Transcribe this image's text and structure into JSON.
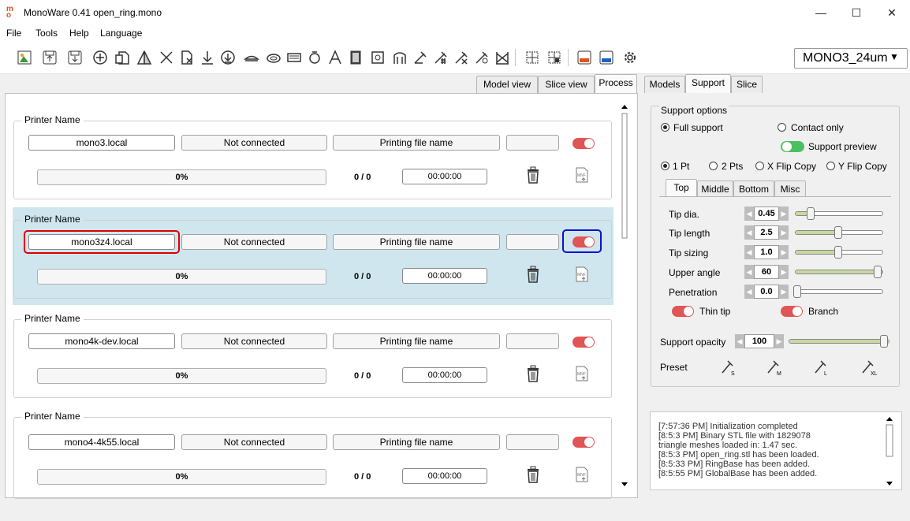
{
  "app": {
    "title": "MonoWare 0.41   open_ring.mono"
  },
  "window_controls": {
    "minimize": "—",
    "maximize": "☐",
    "close": "✕"
  },
  "menu": [
    "File",
    "Tools",
    "Help",
    "Language"
  ],
  "toolbar": {
    "material": "MONO3_24um"
  },
  "view_tabs": [
    "Model view",
    "Slice view",
    "Process"
  ],
  "right_tabs": [
    "Models",
    "Support",
    "Slice"
  ],
  "printers": [
    {
      "group_label": "Printer Name",
      "host": "mono3.local",
      "status": "Not connected",
      "file": "Printing file name",
      "progress": "0%",
      "layers": "0 / 0",
      "time": "00:00:00"
    },
    {
      "group_label": "Printer Name",
      "host": "mono3z4.local",
      "status": "Not connected",
      "file": "Printing file name",
      "progress": "0%",
      "layers": "0 / 0",
      "time": "00:00:00"
    },
    {
      "group_label": "Printer Name",
      "host": "mono4k-dev.local",
      "status": "Not connected",
      "file": "Printing file name",
      "progress": "0%",
      "layers": "0 / 0",
      "time": "00:00:00"
    },
    {
      "group_label": "Printer Name",
      "host": "mono4-4k55.local",
      "status": "Not connected",
      "file": "Printing file name",
      "progress": "0%",
      "layers": "0 / 0",
      "time": "00:00:00"
    }
  ],
  "support": {
    "group_label": "Support options",
    "full_support": "Full support",
    "contact_only": "Contact only",
    "support_preview": "Support preview",
    "pt1": "1 Pt",
    "pt2": "2 Pts",
    "xflip": "X Flip Copy",
    "yflip": "Y Flip Copy",
    "subtabs": [
      "Top",
      "Middle",
      "Bottom",
      "Misc"
    ],
    "params": [
      {
        "label": "Tip dia.",
        "value": "0.45"
      },
      {
        "label": "Tip length",
        "value": "2.5"
      },
      {
        "label": "Tip sizing",
        "value": "1.0"
      },
      {
        "label": "Upper angle",
        "value": "60"
      },
      {
        "label": "Penetration",
        "value": "0.0"
      }
    ],
    "thin_tip": "Thin tip",
    "branch": "Branch",
    "opacity_label": "Support opacity",
    "opacity_value": "100",
    "preset_label": "Preset"
  },
  "log": [
    "[7:57:36 PM]   Initialization completed",
    "[8:5:3 PM]   Binary STL file with 1829078",
    "triangle meshes loaded in: 1.47 sec.",
    "[8:5:3 PM]   open_ring.stl has been loaded.",
    "[8:5:33 PM]   RingBase has been added.",
    "[8:5:55 PM]   GlobalBase has been added."
  ]
}
